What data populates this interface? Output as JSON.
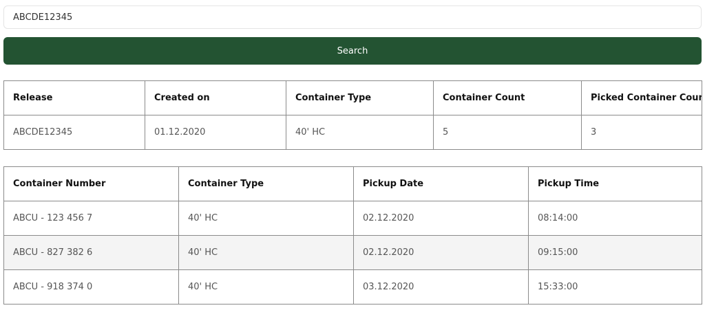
{
  "search": {
    "value": "ABCDE12345",
    "button_label": "Search"
  },
  "release_table": {
    "headers": [
      "Release",
      "Created on",
      "Container Type",
      "Container Count",
      "Picked Container Count"
    ],
    "rows": [
      [
        "ABCDE12345",
        "01.12.2020",
        "40' HC",
        "5",
        "3"
      ]
    ]
  },
  "containers_table": {
    "headers": [
      "Container Number",
      "Container Type",
      "Pickup Date",
      "Pickup Time"
    ],
    "rows": [
      [
        "ABCU - 123 456 7",
        "40' HC",
        "02.12.2020",
        "08:14:00"
      ],
      [
        "ABCU - 827 382 6",
        "40' HC",
        "02.12.2020",
        "09:15:00"
      ],
      [
        "ABCU - 918 374 0",
        "40' HC",
        "03.12.2020",
        "15:33:00"
      ]
    ]
  },
  "colors": {
    "button_background": "#235332",
    "button_text": "#ffffff",
    "table_border": "#8a8a8a",
    "alternate_row": "#f4f4f4"
  }
}
